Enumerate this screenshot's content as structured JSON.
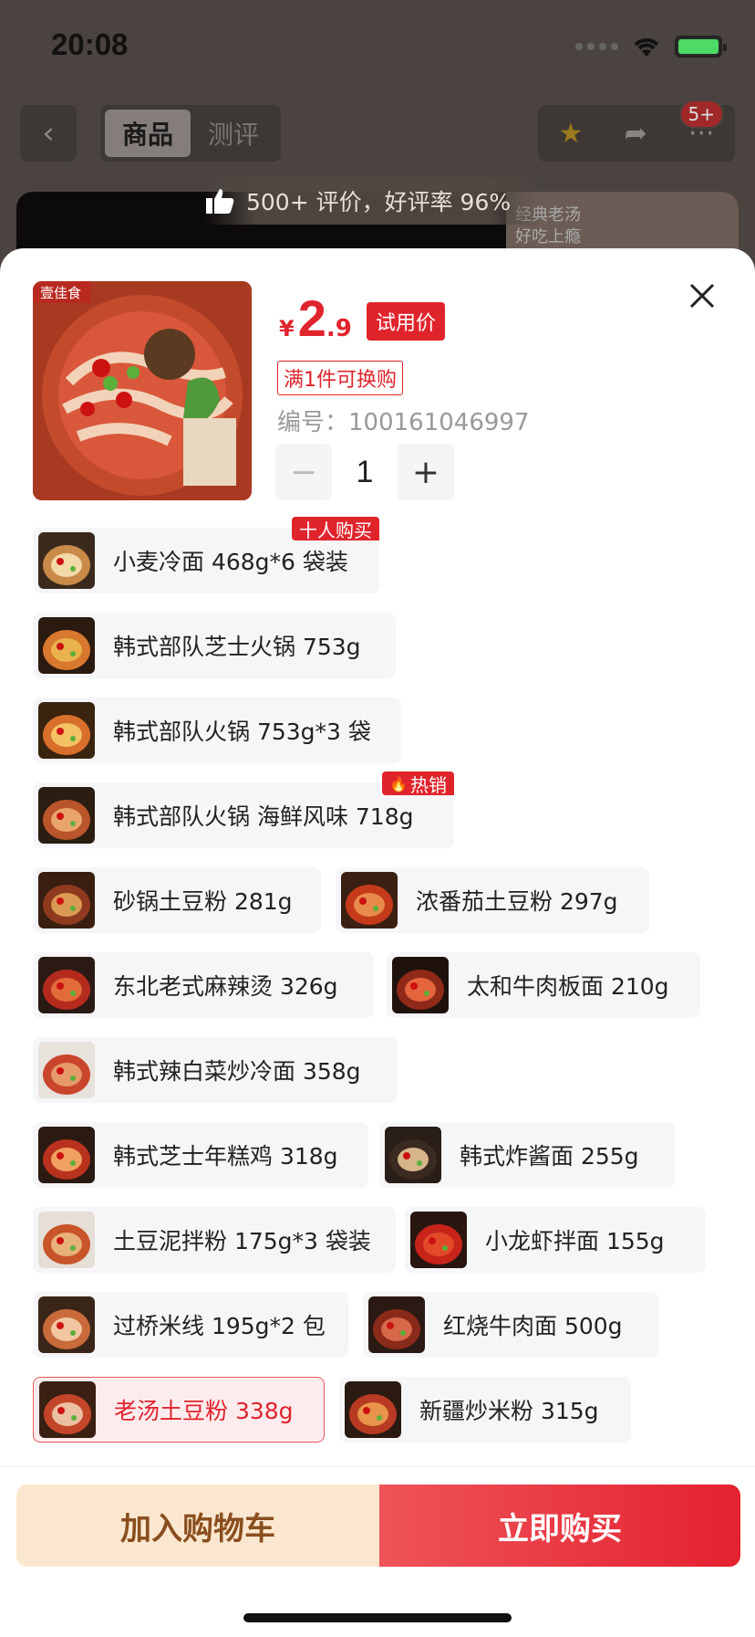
{
  "status_bar": {
    "time": "20:08"
  },
  "nav": {
    "tabs": [
      "商品",
      "测评"
    ],
    "cart_badge": "5+"
  },
  "banner": {
    "rating_text": "500+ 评价，好评率 96%",
    "image_caption": "经典老汤\n好吃上瘾"
  },
  "product": {
    "price_currency": "¥",
    "price_int": "2",
    "price_dec": ".9",
    "price_tag": "试用价",
    "promo": "满1件可换购",
    "sku_label": "编号：",
    "sku": "100161046997",
    "quantity": "1",
    "image_brand": "壹佳食"
  },
  "options": [
    {
      "label": "小麦冷面 468g*6 袋装",
      "tag": "十人购买"
    },
    {
      "label": "韩式部队芝士火锅 753g"
    },
    {
      "label": "韩式部队火锅 753g*3 袋"
    },
    {
      "label": "韩式部队火锅 海鲜风味 718g",
      "tag": "热销"
    },
    {
      "label": "砂锅土豆粉 281g"
    },
    {
      "label": "浓番茄土豆粉 297g"
    },
    {
      "label": "东北老式麻辣烫 326g"
    },
    {
      "label": "太和牛肉板面 210g"
    },
    {
      "label": "韩式辣白菜炒冷面 358g"
    },
    {
      "label": "韩式芝士年糕鸡 318g"
    },
    {
      "label": "韩式炸酱面 255g"
    },
    {
      "label": "土豆泥拌粉 175g*3 袋装"
    },
    {
      "label": "小龙虾拌面 155g"
    },
    {
      "label": "过桥米线 195g*2 包"
    },
    {
      "label": "红烧牛肉面 500g"
    },
    {
      "label": "老汤土豆粉 338g",
      "selected": true
    },
    {
      "label": "新疆炒米粉 315g"
    }
  ],
  "actions": {
    "add_to_cart": "加入购物车",
    "buy_now": "立即购买"
  },
  "colors": {
    "accent": "#e0242c",
    "cart_bg": "#fbe7cf",
    "cart_text": "#8a4e1e"
  }
}
